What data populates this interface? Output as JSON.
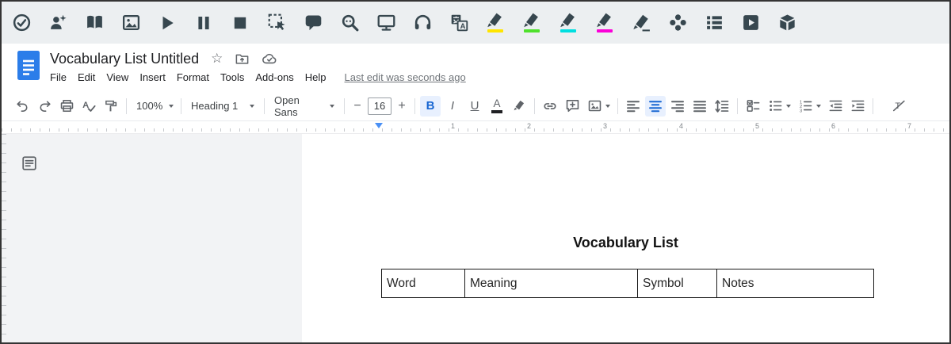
{
  "colors": {
    "rw_toolbar_bg": "#eceff1",
    "rw_icon": "#37474f",
    "highlight_yellow": "#ffe500",
    "highlight_green": "#4fe12c",
    "highlight_cyan": "#00dfe0",
    "highlight_pink": "#fb00d8",
    "active_blue": "#1967d2",
    "active_blue_bg": "#e8f0fe",
    "docs_icon_blue": "#2b7de9",
    "ruler_marker_blue": "#4a90f5"
  },
  "rw_toolbar": {
    "tools": [
      "check",
      "prediction",
      "dictionary",
      "picture-dictionary",
      "play",
      "pause",
      "stop",
      "screenshot-reader",
      "hover-speech",
      "web-search",
      "screen-mask",
      "audio-maker",
      "translator",
      "highlighter-yellow",
      "highlighter-green",
      "highlighter-cyan",
      "highlighter-pink",
      "clear-highlights",
      "collect-highlights",
      "vocabulary-list",
      "practice-video",
      "cube"
    ],
    "translator_letter": "A"
  },
  "header": {
    "title": "Vocabulary List Untitled",
    "last_edit": "Last edit was seconds ago"
  },
  "menubar": {
    "items": [
      "File",
      "Edit",
      "View",
      "Insert",
      "Format",
      "Tools",
      "Add-ons",
      "Help"
    ]
  },
  "toolbar": {
    "zoom": "100%",
    "paragraph_style": "Heading 1",
    "font": "Open Sans",
    "font_size": "16",
    "minus": "−",
    "plus": "+",
    "bold": "B",
    "italic": "I",
    "underline": "U",
    "text_color": "A",
    "spellcheck_letter": "A",
    "clear_letter": "T",
    "num1": "1",
    "num2": "2",
    "num3": "3"
  },
  "ruler": {
    "numbers": [
      "1",
      "2",
      "3",
      "4",
      "5",
      "6",
      "7"
    ]
  },
  "doc": {
    "title": "Vocabulary List",
    "table": {
      "headers": [
        "Word",
        "Meaning",
        "Symbol",
        "Notes"
      ]
    }
  }
}
